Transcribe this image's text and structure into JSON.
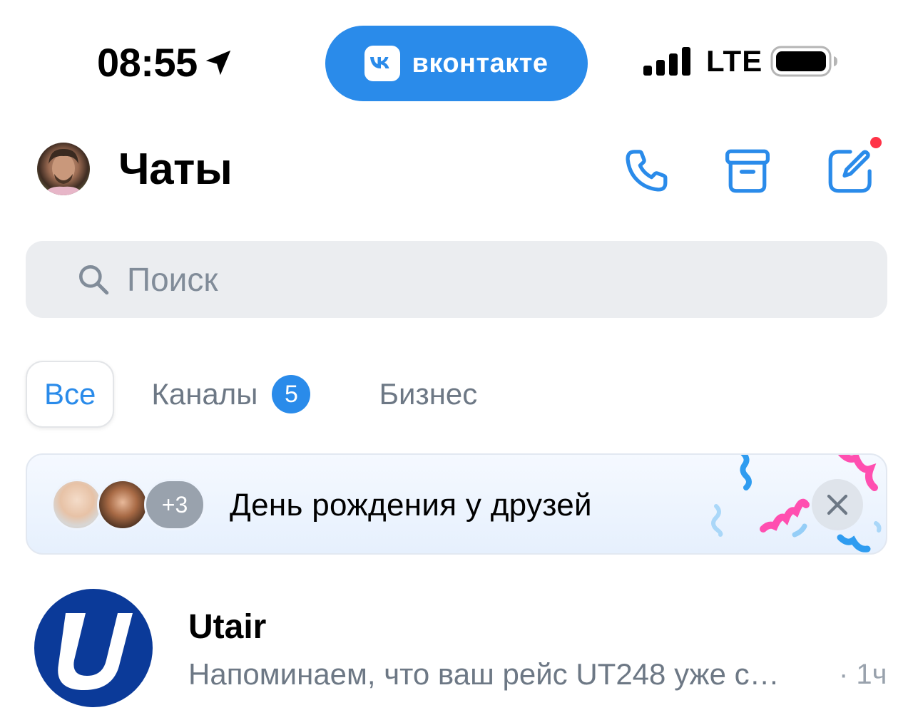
{
  "status_bar": {
    "time": "08:55",
    "app_pill_label": "вконтакте",
    "network": "LTE",
    "icons": [
      "location-arrow-icon",
      "vk-logo-icon",
      "signal-bars-icon",
      "battery-icon"
    ]
  },
  "header": {
    "title": "Чаты",
    "icons": [
      "phone-icon",
      "archive-icon",
      "compose-icon"
    ]
  },
  "search": {
    "placeholder": "Поиск"
  },
  "tabs": [
    {
      "label": "Все",
      "active": true
    },
    {
      "label": "Каналы",
      "badge": "5"
    },
    {
      "label": "Бизнес"
    }
  ],
  "birthday_banner": {
    "more_count": "+3",
    "text": "День рождения у друзей"
  },
  "chats": [
    {
      "name": "Utair",
      "preview": "Напоминаем, что ваш рейс UT248 уже с…",
      "time": "· 1ч"
    }
  ],
  "colors": {
    "accent": "#2a8bea",
    "notification_dot": "#ff3347",
    "utair_blue": "#0b3a99",
    "secondary_text": "#6d7885"
  }
}
